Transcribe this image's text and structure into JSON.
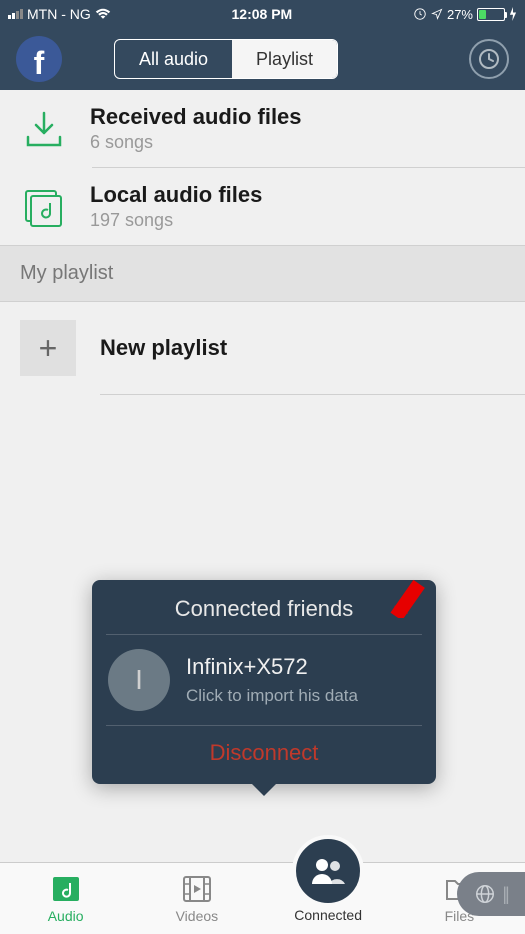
{
  "status": {
    "carrier": "MTN - NG",
    "time": "12:08 PM",
    "battery_pct": "27%"
  },
  "header": {
    "tabs": {
      "all_audio": "All audio",
      "playlist": "Playlist"
    }
  },
  "rows": {
    "received": {
      "title": "Received audio files",
      "sub": "6 songs"
    },
    "local": {
      "title": "Local audio files",
      "sub": "197 songs"
    }
  },
  "sections": {
    "my_playlist": "My playlist"
  },
  "new_playlist": {
    "label": "New playlist"
  },
  "popup": {
    "title": "Connected friends",
    "friend": {
      "initial": "I",
      "name": "Infinix+X572",
      "sub": "Click to import his data"
    },
    "disconnect": "Disconnect"
  },
  "nav": {
    "audio": "Audio",
    "videos": "Videos",
    "connected": "Connected",
    "files": "Files"
  }
}
